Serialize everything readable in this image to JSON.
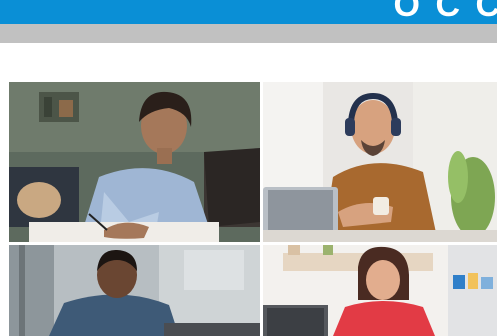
{
  "header": {
    "title_fragment": "O C C"
  },
  "video_tiles": [
    {
      "name": "woman-writing-notes"
    },
    {
      "name": "man-with-headphones"
    },
    {
      "name": "man-at-laptop"
    },
    {
      "name": "woman-smiling"
    }
  ],
  "colors": {
    "header_blue": "#0a8fd6",
    "divider_gray": "#c1c1c1"
  }
}
